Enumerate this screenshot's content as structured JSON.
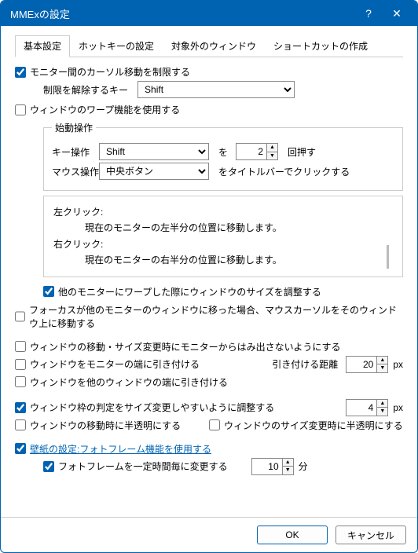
{
  "window": {
    "title": "MMExの設定"
  },
  "tabs": [
    "基本設定",
    "ホットキーの設定",
    "対象外のウィンドウ",
    "ショートカットの作成"
  ],
  "main": {
    "restrict_cursor": "モニター間のカーソル移動を制限する",
    "release_key_label": "制限を解除するキー",
    "release_key_value": "Shift",
    "warp_enable": "ウィンドウのワープ機能を使用する",
    "group_start": "始動操作",
    "key_op_label": "キー操作",
    "key_op_value": "Shift",
    "key_op_wo": "を",
    "key_op_count": "2",
    "key_op_kai": "回押す",
    "mouse_op_label": "マウス操作",
    "mouse_op_value": "中央ボタン",
    "mouse_op_click": "をタイトルバーでクリックする",
    "info_left": "左クリック:",
    "info_left_desc": "現在のモニターの左半分の位置に移動します。",
    "info_right": "右クリック:",
    "info_right_desc": "現在のモニターの右半分の位置に移動します。",
    "adjust_size_on_warp": "他のモニターにワープした際にウィンドウのサイズを調整する",
    "focus_mouse": "フォーカスが他のモニターのウィンドウに移った場合、マウスカーソルをそのウィンドウ上に移動する",
    "no_overflow": "ウィンドウの移動・サイズ変更時にモニターからはみ出さないようにする",
    "snap_monitor": "ウィンドウをモニターの端に引き付ける",
    "snap_distance_label": "引き付ける距離",
    "snap_distance_value": "20",
    "unit_px": "px",
    "snap_window": "ウィンドウを他のウィンドウの端に引き付ける",
    "adjust_frame": "ウィンドウ枠の判定をサイズ変更しやすいように調整する",
    "frame_value": "4",
    "translucent_move": "ウィンドウの移動時に半透明にする",
    "translucent_resize": "ウィンドウのサイズ変更時に半透明にする",
    "wallpaper_link": "壁紙の設定:フォトフレーム機能を使用する",
    "photo_interval": "フォトフレームを一定時間毎に変更する",
    "photo_interval_value": "10",
    "unit_min": "分"
  },
  "buttons": {
    "ok": "OK",
    "cancel": "キャンセル"
  }
}
